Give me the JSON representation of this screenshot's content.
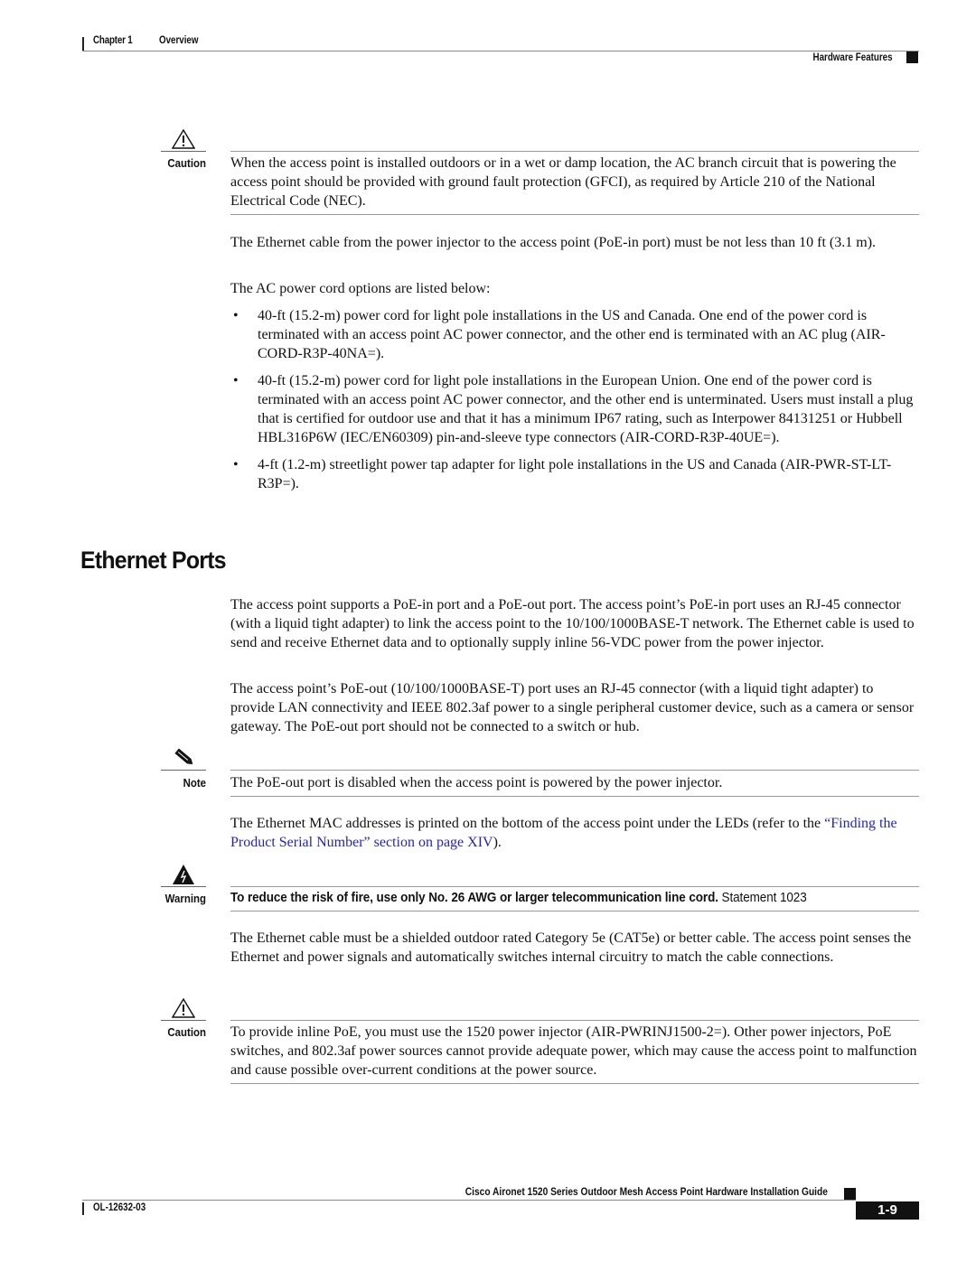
{
  "header": {
    "chapter": "Chapter 1",
    "chapter_title": "Overview",
    "section": "Hardware Features"
  },
  "caution1": {
    "label": "Caution",
    "icon": "caution-triangle-icon",
    "text": "When the access point is installed outdoors or in a wet or damp location, the AC branch circuit that is powering the access point should be provided with ground fault protection (GFCI), as required by Article 210 of the National Electrical Code (NEC)."
  },
  "para_cable_length": "The Ethernet cable from the power injector to the access point (PoE-in port) must be not less than 10 ft (3.1 m).",
  "para_cord_intro": "The AC power cord options are listed below:",
  "cord_options": [
    "40-ft (15.2-m) power cord for light pole installations in the US and Canada. One end of the power cord is terminated with an access point AC power connector, and the other end is terminated with an AC plug (AIR-CORD-R3P-40NA=).",
    "40-ft (15.2-m) power cord for light pole installations in the European Union. One end of the power cord is terminated with an access point AC power connector, and the other end is unterminated. Users must install a plug that is certified for outdoor use and that it has a minimum IP67 rating, such as Interpower 84131251 or Hubbell HBL316P6W (IEC/EN60309) pin-and-sleeve type connectors (AIR-CORD-R3P-40UE=).",
    "4-ft (1.2-m) streetlight power tap adapter for light pole installations in the US and Canada (AIR-PWR-ST-LT-R3P=)."
  ],
  "bullet_glyph": "•",
  "section_heading": "Ethernet Ports",
  "para_ports1": "The access point supports a PoE-in port and a PoE-out port. The access point’s PoE-in port uses an RJ-45 connector (with a liquid tight adapter) to link the access point to the 10/100/1000BASE-T network. The Ethernet cable is used to send and receive Ethernet data and to optionally supply inline 56-VDC power from the power injector.",
  "para_ports2": "The access point’s PoE-out (10/100/1000BASE-T) port uses an RJ-45 connector (with a liquid tight adapter) to provide LAN connectivity and IEEE 802.3af power to a single peripheral customer device, such as a camera or sensor gateway. The PoE-out port should not be connected to a switch or hub.",
  "note": {
    "label": "Note",
    "icon": "note-pencil-icon",
    "text": "The PoE-out port is disabled when the access point is powered by the power injector."
  },
  "para_mac": {
    "text_before": "The Ethernet MAC addresses is printed on the bottom of the access point under the LEDs (refer to the ",
    "link_text": "“Finding the Product Serial Number” section on page XIV",
    "text_after": ")."
  },
  "warning": {
    "label": "Warning",
    "icon": "warning-lightning-icon",
    "text": "To reduce the risk of fire, use only No. 26 AWG or larger telecommunication line cord.",
    "statement": "Statement 1023"
  },
  "para_cat5e": "The Ethernet cable must be a shielded outdoor rated Category 5e (CAT5e) or better cable. The access point senses the Ethernet and power signals and automatically switches internal circuitry to match the cable connections.",
  "caution2": {
    "label": "Caution",
    "icon": "caution-triangle-icon",
    "text": "To provide inline PoE, you must use the 1520 power injector (AIR-PWRINJ1500-2=). Other power injectors, PoE switches, and 802.3af power sources cannot provide adequate power, which may cause the access point to malfunction and cause possible over-current conditions at the power source."
  },
  "footer": {
    "guide_title": "Cisco Aironet 1520 Series Outdoor Mesh Access Point Hardware Installation Guide",
    "doc_number": "OL-12632-03",
    "page_number": "1-9"
  },
  "colors": {
    "link": "#2222cc",
    "text": "#111111",
    "rule": "#999999"
  }
}
